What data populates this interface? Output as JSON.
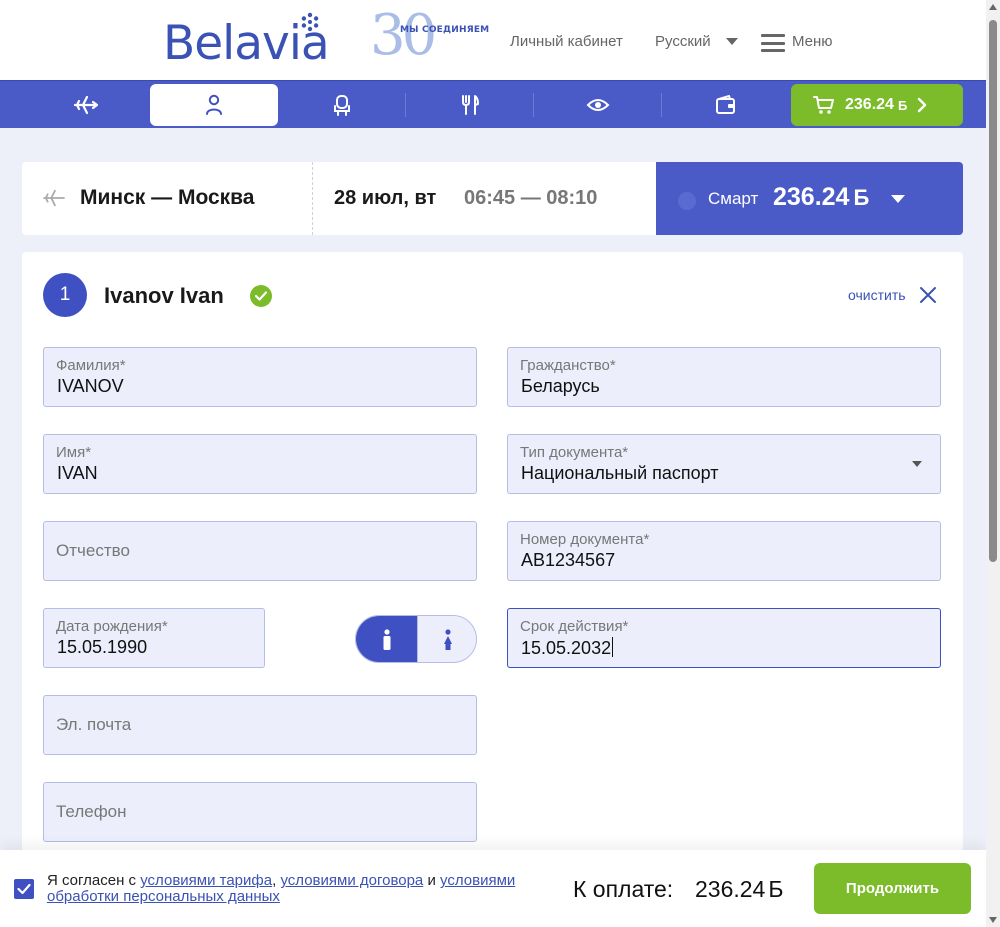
{
  "header": {
    "logo_text": "Belavia",
    "anniversary_number": "30",
    "anniversary_tagline": "МЫ СОЕДИНЯЕМ",
    "cabinet_link": "Личный кабинет",
    "language": "Русский",
    "menu_label": "Меню"
  },
  "steps": {
    "icons": [
      "plane-icon",
      "passenger-icon",
      "seat-icon",
      "meal-icon",
      "eye-icon",
      "wallet-icon"
    ],
    "active": "passenger-icon",
    "cart_amount": "236.24",
    "cart_currency": "Б"
  },
  "flight": {
    "route": "Минск — Москва",
    "date": "28 июл, вт",
    "time": "06:45 — 08:10",
    "fare_name": "Смарт",
    "fare_price": "236.24",
    "fare_currency": "Б"
  },
  "passenger": {
    "number": "1",
    "name": "Ivanov Ivan",
    "clear_label": "очистить",
    "fields": {
      "surname": {
        "label": "Фамилия*",
        "value": "IVANOV"
      },
      "name": {
        "label": "Имя*",
        "value": "IVAN"
      },
      "patronymic": {
        "placeholder": "Отчество"
      },
      "birthdate": {
        "label": "Дата рождения*",
        "value": "15.05.1990"
      },
      "email": {
        "placeholder": "Эл. почта"
      },
      "phone": {
        "placeholder": "Телефон"
      },
      "citizenship": {
        "label": "Гражданство*",
        "value": "Беларусь"
      },
      "doc_type": {
        "label": "Тип документа*",
        "value": "Национальный паспорт"
      },
      "doc_number": {
        "label": "Номер документа*",
        "value": "AB1234567"
      },
      "doc_expiry": {
        "label": "Срок действия*",
        "value": "15.05.2032"
      }
    },
    "gender_selected": "male"
  },
  "footer": {
    "agree_prefix": "Я согласен с ",
    "link_tariff": "условиями тарифа",
    "sep_comma": ", ",
    "link_contract": "условиями договора",
    "sep_and": " и ",
    "link_personal": "условиями обработки персональных данных",
    "total_label": "К оплате:",
    "total_amount": "236.24",
    "total_currency": "Б",
    "continue_label": "Продолжить"
  },
  "colors": {
    "brand_blue": "#4a5bc8",
    "accent_green": "#7cbc2a",
    "field_bg": "#eceffb"
  }
}
